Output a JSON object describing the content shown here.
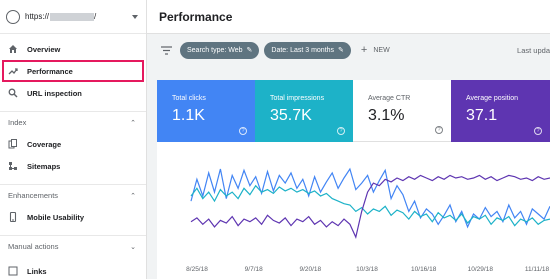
{
  "property": {
    "prefix": "https://",
    "suffix": "/"
  },
  "page_title": "Performance",
  "sidebar": {
    "top_items": [
      {
        "label": "Overview",
        "icon": "home-icon"
      },
      {
        "label": "Performance",
        "icon": "trending-up-icon"
      },
      {
        "label": "URL inspection",
        "icon": "search-icon"
      }
    ],
    "index_section": "Index",
    "index_items": [
      {
        "label": "Coverage",
        "icon": "file-copy-icon"
      },
      {
        "label": "Sitemaps",
        "icon": "sitemap-icon"
      }
    ],
    "enhancements_section": "Enhancements",
    "enhancement_items": [
      {
        "label": "Mobile Usability",
        "icon": "phone-icon"
      }
    ],
    "manual_section": "Manual actions",
    "partial_item": "Links"
  },
  "filters": {
    "chip1": "Search type: Web",
    "chip2": "Date: Last 3 months",
    "new_label": "NEW",
    "last_updated": "Last upda"
  },
  "metrics": [
    {
      "label": "Total clicks",
      "value": "1.1K",
      "bg": "#4285f4",
      "fg": "#ffffff"
    },
    {
      "label": "Total impressions",
      "value": "35.7K",
      "bg": "#1db2c8",
      "fg": "#ffffff"
    },
    {
      "label": "Average CTR",
      "value": "3.1%",
      "bg": "#ffffff",
      "fg": "#5f6368"
    },
    {
      "label": "Average position",
      "value": "37.1",
      "bg": "#5e35b1",
      "fg": "#ffffff"
    }
  ],
  "chart_data": {
    "type": "line",
    "x_tick_labels": [
      "8/25/18",
      "9/7/18",
      "9/20/18",
      "10/3/18",
      "10/16/18",
      "10/29/18",
      "11/11/18"
    ],
    "series": [
      {
        "color": "#4285f4",
        "values": [
          38,
          55,
          42,
          60,
          45,
          63,
          40,
          58,
          48,
          62,
          50,
          57,
          44,
          61,
          46,
          58,
          52,
          60,
          48,
          55,
          42,
          57,
          45,
          53,
          60,
          48,
          56,
          63,
          47,
          52,
          58,
          45,
          54,
          62,
          40,
          50,
          43,
          30,
          38,
          25,
          32,
          28,
          20,
          27,
          35,
          22,
          30,
          18,
          28,
          24,
          33,
          26,
          30,
          22,
          35,
          25,
          30,
          20,
          32,
          28,
          24,
          34
        ]
      },
      {
        "color": "#1db2c8",
        "values": [
          42,
          48,
          40,
          45,
          38,
          47,
          42,
          45,
          40,
          48,
          43,
          50,
          45,
          47,
          44,
          49,
          46,
          48,
          45,
          47,
          44,
          46,
          42,
          44,
          40,
          38,
          36,
          35,
          30,
          33,
          28,
          32,
          30,
          34,
          27,
          31,
          29,
          24,
          30,
          26,
          28,
          22,
          29,
          25,
          27,
          23,
          28,
          21,
          26,
          24,
          27,
          20,
          25,
          23,
          26,
          19,
          24,
          22,
          25,
          20,
          23,
          24
        ]
      },
      {
        "color": "#5e35b1",
        "values": [
          22,
          25,
          20,
          24,
          18,
          23,
          21,
          26,
          19,
          24,
          22,
          25,
          20,
          27,
          23,
          21,
          25,
          19,
          24,
          22,
          26,
          20,
          23,
          18,
          22,
          19,
          24,
          20,
          10,
          30,
          45,
          52,
          50,
          55,
          53,
          56,
          54,
          57,
          55,
          58,
          56,
          54,
          57,
          55,
          58,
          56,
          57,
          55,
          56,
          58,
          55,
          57,
          54,
          56,
          58,
          57,
          55,
          56,
          54,
          57,
          55,
          56
        ]
      }
    ]
  }
}
